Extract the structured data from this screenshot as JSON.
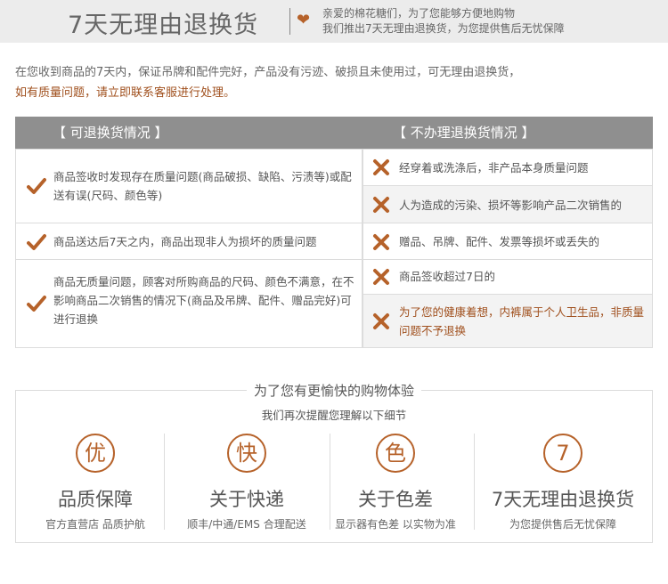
{
  "header": {
    "title": "7天无理由退换货",
    "note_line1": "亲爱的棉花糖们，为了您能够方便地购物",
    "note_line2": "我们推出7天无理由退换货，为您提供售后无忧保障",
    "heart_icon": "heart-icon",
    "accent_color": "#b6622a"
  },
  "intro": {
    "line1": "在您收到商品的7天内，保证吊牌和配件完好，产品没有污迹、破损且未使用过，可无理由退换货，",
    "line2": "如有质量问题，请立即联系客服进行处理。"
  },
  "table": {
    "left_header": "【 可退换货情况 】",
    "right_header": "【 不办理退换货情况 】",
    "left_rows": [
      "商品签收时发现存在质量问题(商品破损、缺陷、污渍等)或配送有误(尺码、颜色等)",
      "商品送达后7天之内，商品出现非人为损坏的质量问题",
      "商品无质量问题，顾客对所购商品的尺码、颜色不满意，在不影响商品二次销售的情况下(商品及吊牌、配件、赠品完好)可进行退换"
    ],
    "right_rows": [
      "经穿着或洗涤后，非产品本身质量问题",
      "人为造成的污染、损坏等影响产品二次销售的",
      "赠品、吊牌、配件、发票等损坏或丢失的",
      "商品签收超过7日的",
      "为了您的健康着想，内裤属于个人卫生品，非质量问题不予退换"
    ]
  },
  "panel": {
    "title": "为了您有更愉快的购物体验",
    "subtitle": "我们再次提醒您理解以下细节",
    "features": [
      {
        "glyph": "优",
        "name": "品质保障",
        "desc": "官方直营店 品质护航"
      },
      {
        "glyph": "快",
        "name": "关于快递",
        "desc": "顺丰/中通/EMS 合理配送"
      },
      {
        "glyph": "色",
        "name": "关于色差",
        "desc": "显示器有色差 以实物为准"
      },
      {
        "glyph": "7",
        "name": "7天无理由退换货",
        "desc": "为您提供售后无忧保障"
      }
    ]
  }
}
